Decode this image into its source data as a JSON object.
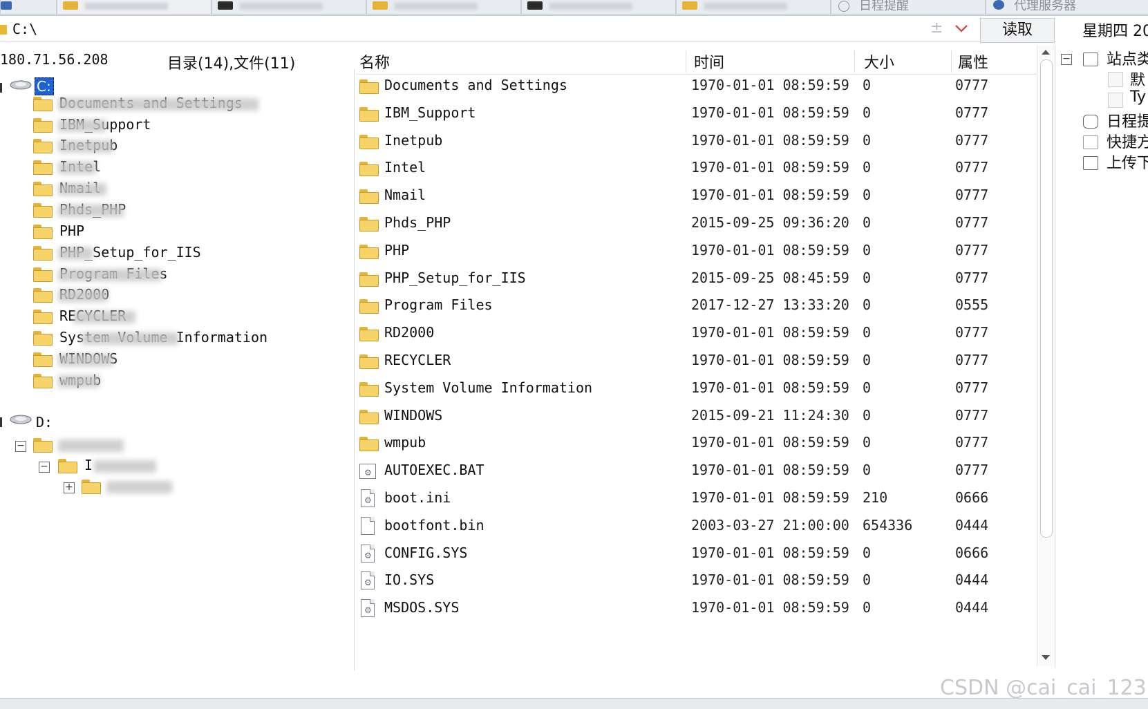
{
  "tabs": [
    {
      "label": "",
      "color": "#3b67b3"
    },
    {
      "label": "",
      "color": "#e6b338"
    },
    {
      "label": "",
      "color": "#2b2b2b"
    },
    {
      "label": "",
      "color": "#e6b338"
    },
    {
      "label": "",
      "color": "#2b2b2b"
    },
    {
      "label": "",
      "color": "#e6b338"
    },
    {
      "label": "日程提醒",
      "color": "#8a8f98"
    },
    {
      "label": "代理服务器",
      "color": "#3b67b3"
    }
  ],
  "address": {
    "path": "C:\\",
    "plus": "±",
    "read_label": "读取",
    "day": "星期四 20"
  },
  "info": {
    "ip": "180.71.56.208",
    "dircount": "目录(14),文件(11)"
  },
  "tree": {
    "c_drive": "C:",
    "d_drive": "D:",
    "items": [
      {
        "label": "Documents and Settings"
      },
      {
        "label": "IBM_Support"
      },
      {
        "label": "Inetpub"
      },
      {
        "label": "Intel"
      },
      {
        "label": "Nmail"
      },
      {
        "label": "Phds_PHP"
      },
      {
        "label": "PHP"
      },
      {
        "label": "PHP_Setup_for_IIS"
      },
      {
        "label": "Program Files"
      },
      {
        "label": "RD2000"
      },
      {
        "label": "RECYCLER"
      },
      {
        "label": "System Volume Information"
      },
      {
        "label": "WINDOWS"
      },
      {
        "label": "wmpub"
      }
    ],
    "d_items": [
      {
        "label": "I"
      },
      {
        "label": ""
      }
    ]
  },
  "list": {
    "headers": {
      "name": "名称",
      "time": "时间",
      "size": "大小",
      "attr": "属性"
    },
    "rows": [
      {
        "name": "Documents and Settings",
        "time": "1970-01-01 08:59:59",
        "size": "0",
        "attr": "0777",
        "type": "folder"
      },
      {
        "name": "IBM_Support",
        "time": "1970-01-01 08:59:59",
        "size": "0",
        "attr": "0777",
        "type": "folder"
      },
      {
        "name": "Inetpub",
        "time": "1970-01-01 08:59:59",
        "size": "0",
        "attr": "0777",
        "type": "folder"
      },
      {
        "name": "Intel",
        "time": "1970-01-01 08:59:59",
        "size": "0",
        "attr": "0777",
        "type": "folder"
      },
      {
        "name": "Nmail",
        "time": "1970-01-01 08:59:59",
        "size": "0",
        "attr": "0777",
        "type": "folder"
      },
      {
        "name": "Phds_PHP",
        "time": "2015-09-25 09:36:20",
        "size": "0",
        "attr": "0777",
        "type": "folder"
      },
      {
        "name": "PHP",
        "time": "1970-01-01 08:59:59",
        "size": "0",
        "attr": "0777",
        "type": "folder"
      },
      {
        "name": "PHP_Setup_for_IIS",
        "time": "2015-09-25 08:45:59",
        "size": "0",
        "attr": "0777",
        "type": "folder"
      },
      {
        "name": "Program Files",
        "time": "2017-12-27 13:33:20",
        "size": "0",
        "attr": "0555",
        "type": "folder"
      },
      {
        "name": "RD2000",
        "time": "1970-01-01 08:59:59",
        "size": "0",
        "attr": "0777",
        "type": "folder"
      },
      {
        "name": "RECYCLER",
        "time": "1970-01-01 08:59:59",
        "size": "0",
        "attr": "0777",
        "type": "folder"
      },
      {
        "name": "System Volume Information",
        "time": "1970-01-01 08:59:59",
        "size": "0",
        "attr": "0777",
        "type": "folder"
      },
      {
        "name": "WINDOWS",
        "time": "2015-09-21 11:24:30",
        "size": "0",
        "attr": "0777",
        "type": "folder"
      },
      {
        "name": "wmpub",
        "time": "1970-01-01 08:59:59",
        "size": "0",
        "attr": "0777",
        "type": "folder"
      },
      {
        "name": "AUTOEXEC.BAT",
        "time": "1970-01-01 08:59:59",
        "size": "0",
        "attr": "0777",
        "type": "bat"
      },
      {
        "name": "boot.ini",
        "time": "1970-01-01 08:59:59",
        "size": "210",
        "attr": "0666",
        "type": "ini"
      },
      {
        "name": "bootfont.bin",
        "time": "2003-03-27 21:00:00",
        "size": "654336",
        "attr": "0444",
        "type": "file"
      },
      {
        "name": "CONFIG.SYS",
        "time": "1970-01-01 08:59:59",
        "size": "0",
        "attr": "0666",
        "type": "sys"
      },
      {
        "name": "IO.SYS",
        "time": "1970-01-01 08:59:59",
        "size": "0",
        "attr": "0444",
        "type": "sys"
      },
      {
        "name": "MSDOS.SYS",
        "time": "1970-01-01 08:59:59",
        "size": "0",
        "attr": "0444",
        "type": "sys"
      }
    ]
  },
  "right_panel": {
    "items": [
      {
        "label": "站点类",
        "icon": "site-icon"
      },
      {
        "label": "默",
        "icon": "checkbox"
      },
      {
        "label": "Ty",
        "icon": "checkbox"
      },
      {
        "label": "日程提",
        "icon": "schedule-icon"
      },
      {
        "label": "快捷方",
        "icon": "shortcut-icon"
      },
      {
        "label": "上传下",
        "icon": "upload-icon"
      }
    ]
  },
  "watermark": "CSDN @cai_cai_123"
}
